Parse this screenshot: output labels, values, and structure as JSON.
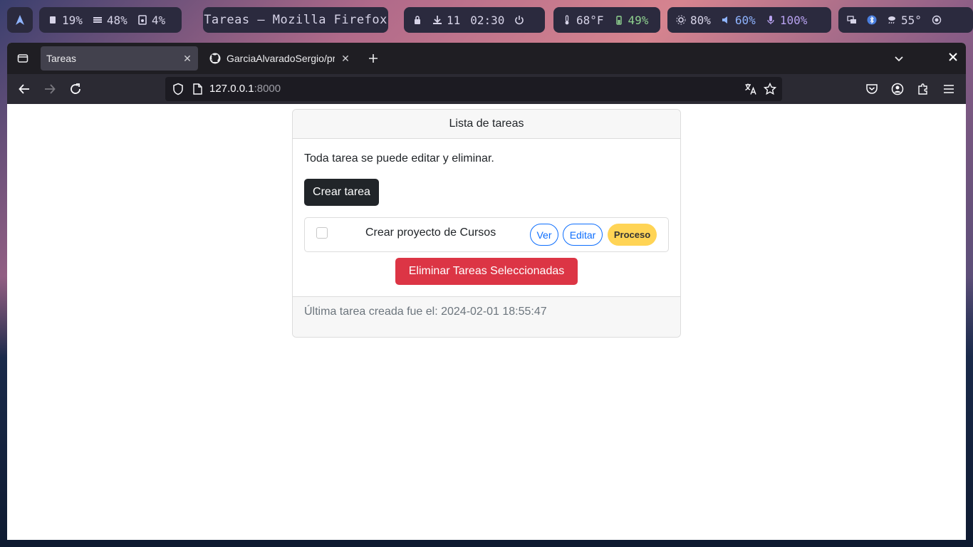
{
  "topbar": {
    "cpu": "19%",
    "memory": "48%",
    "disk": "4%",
    "window_title": "Tareas — Mozilla Firefox",
    "updates": "11",
    "time": "02:30",
    "temperature": "68°F",
    "battery": "49%",
    "brightness": "80%",
    "volume": "60%",
    "mic": "100%",
    "weather": "55°"
  },
  "browser": {
    "tabs": [
      {
        "label": "Tareas"
      },
      {
        "label": "GarciaAlvaradoSergio/pru"
      }
    ],
    "url_host": "127.0.0.1",
    "url_port": ":8000"
  },
  "page": {
    "card_header": "Lista de tareas",
    "intro": "Toda tarea se puede editar y eliminar.",
    "create_button": "Crear tarea",
    "tasks": [
      {
        "title": "Crear proyecto de Cursos",
        "view_label": "Ver",
        "edit_label": "Editar",
        "status": "Proceso"
      }
    ],
    "delete_selected_button": "Eliminar Tareas Seleccionadas",
    "footer": "Última tarea creada fue el: 2024-02-01 18:55:47"
  },
  "colors": {
    "primary": "#0d6efd",
    "danger": "#dc3545",
    "dark": "#212529",
    "warning": "#ffd455"
  }
}
